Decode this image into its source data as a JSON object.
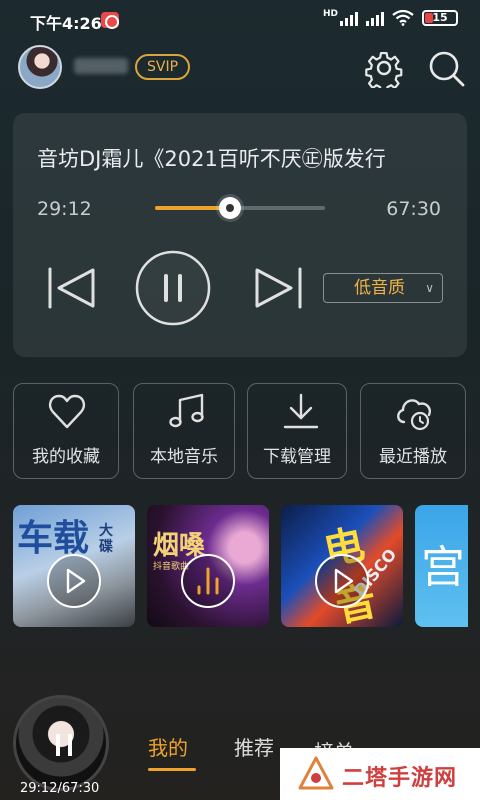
{
  "status_bar": {
    "time": "下午4:26",
    "network": "HD",
    "battery": "15"
  },
  "header": {
    "vip_badge": "SVIP"
  },
  "player": {
    "song_title": "音坊DJ霜儿《2021百听不厌㊣版发行",
    "current_time": "29:12",
    "total_time": "67:30",
    "progress": 0.44,
    "quality_label": "低音质"
  },
  "shortcuts": [
    {
      "label": "我的收藏",
      "icon": "heart-icon"
    },
    {
      "label": "本地音乐",
      "icon": "music-note-icon"
    },
    {
      "label": "下载管理",
      "icon": "download-icon"
    },
    {
      "label": "最近播放",
      "icon": "cloud-clock-icon"
    }
  ],
  "albums": [
    {
      "cover_text": "车载",
      "cover_sub": "大碟",
      "state": "play"
    },
    {
      "cover_text": "烟嗓",
      "cover_sub": "抖音歌曲",
      "state": "playing"
    },
    {
      "cover_text": "电音",
      "cover_sub": "DISCO",
      "state": "play"
    },
    {
      "cover_text": "宫",
      "cover_sub": "",
      "state": "none"
    }
  ],
  "mini_player": {
    "time": "29:12/67:30"
  },
  "bottom_nav": [
    {
      "label": "我的",
      "active": true
    },
    {
      "label": "推荐",
      "active": false
    },
    {
      "label": "榜单",
      "active": false
    }
  ],
  "watermark": {
    "text": "二塔手游网"
  },
  "colors": {
    "accent": "#f0a32c",
    "vip": "#e7b24a"
  }
}
